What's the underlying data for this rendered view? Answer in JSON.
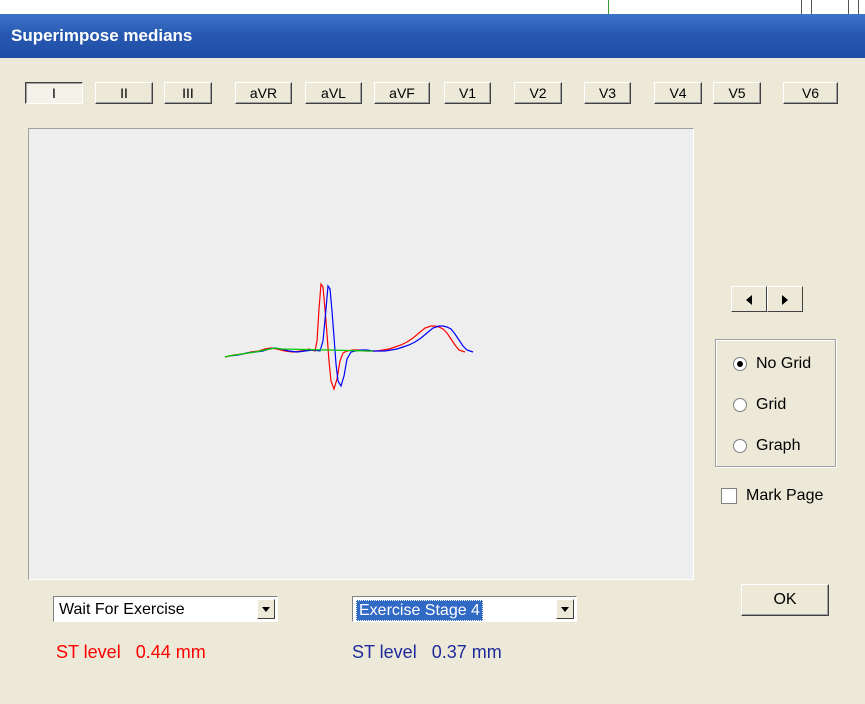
{
  "window": {
    "title": "Superimpose medians"
  },
  "leads": {
    "active": "I",
    "items": [
      "I",
      "II",
      "III",
      "aVR",
      "aVL",
      "aVF",
      "V1",
      "V2",
      "V3",
      "V4",
      "V5",
      "V6"
    ]
  },
  "navigation": {
    "prev_icon": "left-arrow-icon",
    "next_icon": "right-arrow-icon"
  },
  "display_mode": {
    "selected": "No Grid",
    "options": [
      "No Grid",
      "Grid",
      "Graph"
    ]
  },
  "mark_page": {
    "label": "Mark Page",
    "checked": false
  },
  "ok_button": {
    "label": "OK"
  },
  "left_stage": {
    "value": "Wait For Exercise",
    "st_label": "ST level",
    "st_value": "0.44 mm",
    "color": "#ff0000"
  },
  "right_stage": {
    "value": "Exercise Stage 4",
    "st_label": "ST level",
    "st_value": "0.37 mm",
    "color": "#1f2a9a"
  },
  "colors": {
    "title_bar": "#2859b1",
    "window": "#ece9d8",
    "trace_red": "#ff0000",
    "trace_blue": "#0000ff",
    "trace_green": "#00cc00"
  }
}
